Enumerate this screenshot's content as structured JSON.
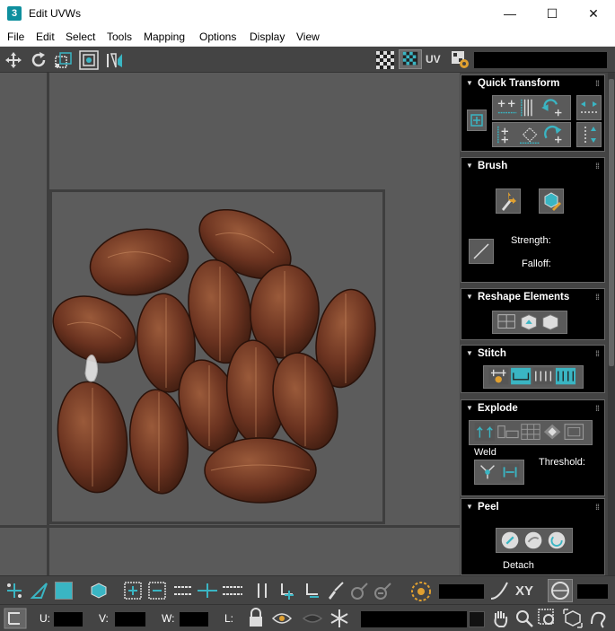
{
  "window": {
    "app_icon": "3",
    "title": "Edit UVWs",
    "minimize": "—",
    "maximize": "☐",
    "close": "✕"
  },
  "menu": [
    "File",
    "Edit",
    "Select",
    "Tools",
    "Mapping",
    "Options",
    "Display",
    "View"
  ],
  "toolbar": {
    "uv_label": "UV",
    "icons": [
      "move-icon",
      "rotate-icon",
      "scale-icon",
      "freeform-icon",
      "mirror-icon",
      "checker-pattern-icon",
      "texture-pattern-icon",
      "uv-settings-icon"
    ]
  },
  "panel": {
    "quick_transform": {
      "title": "Quick Transform"
    },
    "brush": {
      "title": "Brush",
      "strength_label": "Strength:",
      "falloff_label": "Falloff:"
    },
    "reshape": {
      "title": "Reshape Elements"
    },
    "stitch": {
      "title": "Stitch"
    },
    "explode": {
      "title": "Explode",
      "weld_label": "Weld",
      "threshold_label": "Threshold:"
    },
    "peel": {
      "title": "Peel",
      "detach_label": "Detach"
    }
  },
  "bottom": {
    "xy_label": "XY",
    "u_label": "U:",
    "v_label": "V:",
    "w_label": "W:",
    "l_label": "L:"
  },
  "colors": {
    "accent": "#3ab5c3",
    "panel_bg": "#000000",
    "viewport_bg": "#5a5a5a",
    "ui_bg": "#444444"
  }
}
